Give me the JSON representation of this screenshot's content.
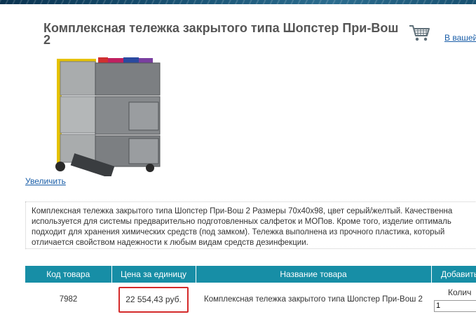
{
  "product": {
    "title": "Комплексная тележка закрытого типа Шопстер При-Вош 2",
    "zoom_link": "Увеличить",
    "description": "Комплексная тележка закрытого типа Шопстер При-Вош 2 Размеры 70х40х98, цвет серый/желтый. Качественна\nиспользуется для системы предварительно подготовленных салфеток и МОПов. Кроме того, изделие оптималь\nподходит для хранения химических средств (под замком). Тележка выполнена из прочного пластика, который\nотличается свойством надежности к любым видам средств дезинфекции."
  },
  "cart": {
    "link_text": "В вашей",
    "icon": "shopping-cart-icon"
  },
  "table": {
    "headers": [
      "Код товара",
      "Цена за единицу",
      "Название товара",
      "Добавить"
    ],
    "rows": [
      {
        "code": "7982",
        "price": "22 554,43 руб.",
        "name": "Комплексная тележка закрытого типа Шопстер При-Вош 2",
        "qty_label": "Колич",
        "qty_value": "1"
      }
    ]
  },
  "colors": {
    "table_header": "#178ea6",
    "price_highlight": "#d42a2a",
    "link": "#1a5ea8"
  }
}
